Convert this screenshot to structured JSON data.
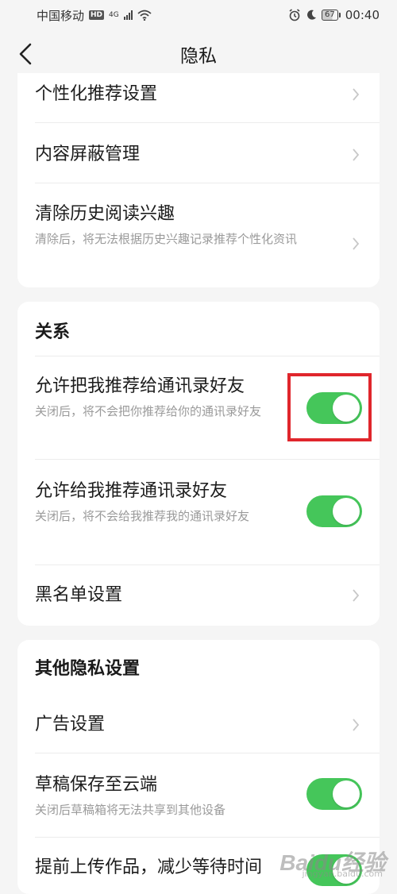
{
  "status_bar": {
    "carrier": "中国移动",
    "hd": "HD",
    "network": "4G",
    "battery": "67",
    "time": "00:40"
  },
  "header": {
    "title": "隐私"
  },
  "card1": {
    "items": [
      {
        "title": "个性化推荐设置"
      },
      {
        "title": "内容屏蔽管理"
      },
      {
        "title": "清除历史阅读兴趣",
        "desc": "清除后，将无法根据历史兴趣记录推荐个性化资讯"
      }
    ]
  },
  "relations": {
    "title": "关系",
    "items": [
      {
        "title": "允许把我推荐给通讯录好友",
        "desc": "关闭后，将不会把你推荐给你的通讯录好友",
        "toggle_on": true
      },
      {
        "title": "允许给我推荐通讯录好友",
        "desc": "关闭后，将不会给我推荐我的通讯录好友",
        "toggle_on": true
      },
      {
        "title": "黑名单设置"
      }
    ]
  },
  "other": {
    "title": "其他隐私设置",
    "items": [
      {
        "title": "广告设置"
      },
      {
        "title": "草稿保存至云端",
        "desc": "关闭后草稿箱将无法共享到其他设备",
        "toggle_on": true
      },
      {
        "title": "提前上传作品，减少等待时间",
        "toggle_on": true
      }
    ]
  },
  "watermark": {
    "text": "Baidu经验",
    "sub": "jingyan.baidu.com"
  },
  "colors": {
    "toggle_on": "#45c65a",
    "highlight": "#e0262c",
    "background": "#f5f5f5"
  }
}
